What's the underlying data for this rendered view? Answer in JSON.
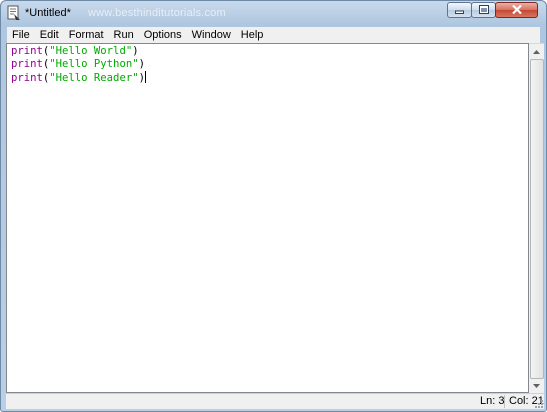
{
  "window": {
    "title": "*Untitled*",
    "watermark": "www.besthinditutorials.com"
  },
  "menu": [
    "File",
    "Edit",
    "Format",
    "Run",
    "Options",
    "Window",
    "Help"
  ],
  "editor": {
    "lines": [
      {
        "keyword": "print",
        "open": "(",
        "string": "\"Hello World\"",
        "close": ")"
      },
      {
        "keyword": "print",
        "open": "(",
        "string": "\"Hello Python\"",
        "close": ")"
      },
      {
        "keyword": "print",
        "open": "(",
        "string": "\"Hello Reader\"",
        "close": ")"
      }
    ]
  },
  "status": {
    "line": "Ln: 3",
    "column": "Col: 21"
  },
  "colors": {
    "keyword": "#900090",
    "string": "#00aa00"
  },
  "icons": {
    "app": "python-idle-icon",
    "minimize": "minimize-icon",
    "maximize": "maximize-icon",
    "close": "close-icon"
  }
}
